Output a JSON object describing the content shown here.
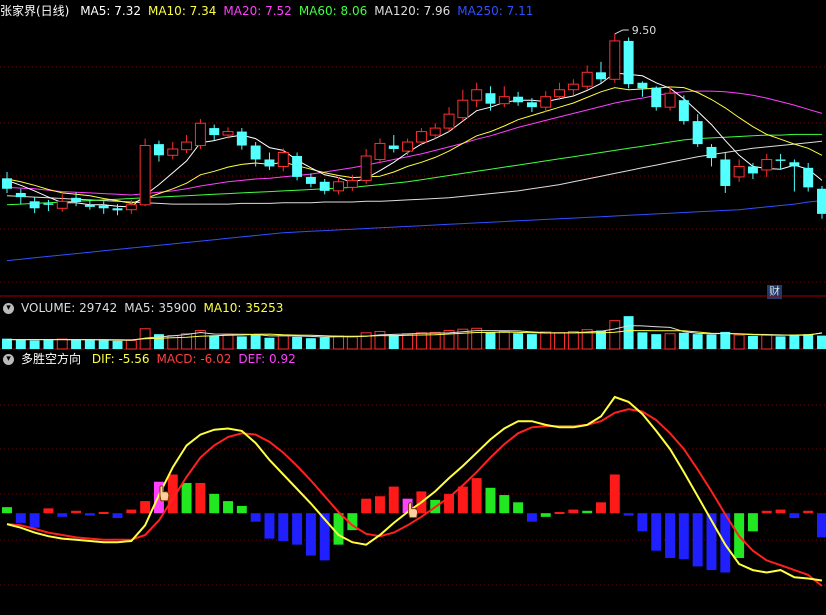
{
  "main_legend": {
    "name": "张家界(日线)",
    "items": [
      {
        "label": "MA5: 7.32",
        "color": "#ffffff"
      },
      {
        "label": "MA10: 7.34",
        "color": "#ffff40"
      },
      {
        "label": "MA20: 7.52",
        "color": "#ff40ff"
      },
      {
        "label": "MA60: 8.06",
        "color": "#40ff40"
      },
      {
        "label": "MA120: 7.96",
        "color": "#dddddd"
      },
      {
        "label": "MA250: 7.11",
        "color": "#3050ff"
      }
    ]
  },
  "volume_legend": {
    "items": [
      {
        "label": "VOLUME: 29742",
        "color": "#dddddd"
      },
      {
        "label": "MA5: 35900",
        "color": "#dddddd"
      },
      {
        "label": "MA10: 35253",
        "color": "#ffff40"
      }
    ]
  },
  "indicator_legend": {
    "name": "多胜空方向",
    "items": [
      {
        "label": "DIF: -5.56",
        "color": "#ffff40"
      },
      {
        "label": "MACD: -6.02",
        "color": "#ff4040"
      },
      {
        "label": "DEF: 0.92",
        "color": "#ff40ff"
      }
    ]
  },
  "badge": "财",
  "chart_data": {
    "type": "candlestick",
    "price_ylim": [
      5.9,
      9.7
    ],
    "high_marker": "9.50",
    "candles": [
      [
        7.43,
        7.28,
        7.52,
        7.22
      ],
      [
        7.22,
        7.16,
        7.28,
        7.06
      ],
      [
        7.1,
        7.0,
        7.16,
        6.93
      ],
      [
        7.07,
        7.05,
        7.12,
        6.96
      ],
      [
        7.0,
        7.1,
        7.2,
        6.95
      ],
      [
        7.15,
        7.09,
        7.23,
        7.03
      ],
      [
        7.05,
        7.02,
        7.12,
        6.98
      ],
      [
        7.04,
        7.0,
        7.1,
        6.92
      ],
      [
        7.0,
        6.97,
        7.06,
        6.9
      ],
      [
        6.98,
        7.05,
        7.12,
        6.92
      ],
      [
        7.05,
        7.9,
        8.0,
        7.03
      ],
      [
        7.92,
        7.76,
        7.97,
        7.67
      ],
      [
        7.76,
        7.85,
        7.95,
        7.7
      ],
      [
        7.84,
        7.95,
        8.05,
        7.79
      ],
      [
        7.9,
        8.22,
        8.28,
        7.85
      ],
      [
        8.15,
        8.05,
        8.2,
        7.98
      ],
      [
        8.05,
        8.1,
        8.16,
        8.0
      ],
      [
        8.1,
        7.9,
        8.15,
        7.84
      ],
      [
        7.9,
        7.7,
        7.95,
        7.6
      ],
      [
        7.7,
        7.6,
        7.8,
        7.55
      ],
      [
        7.6,
        7.8,
        7.86,
        7.53
      ],
      [
        7.75,
        7.45,
        7.8,
        7.4
      ],
      [
        7.45,
        7.35,
        7.5,
        7.3
      ],
      [
        7.38,
        7.25,
        7.42,
        7.2
      ],
      [
        7.25,
        7.38,
        7.45,
        7.2
      ],
      [
        7.3,
        7.4,
        7.48,
        7.25
      ],
      [
        7.4,
        7.75,
        7.85,
        7.35
      ],
      [
        7.7,
        7.93,
        8.0,
        7.65
      ],
      [
        7.9,
        7.85,
        8.05,
        7.8
      ],
      [
        7.82,
        7.95,
        8.0,
        7.76
      ],
      [
        7.95,
        8.1,
        8.15,
        7.9
      ],
      [
        8.05,
        8.15,
        8.22,
        8.0
      ],
      [
        8.15,
        8.35,
        8.45,
        8.1
      ],
      [
        8.3,
        8.55,
        8.7,
        8.25
      ],
      [
        8.55,
        8.7,
        8.8,
        8.45
      ],
      [
        8.65,
        8.5,
        8.75,
        8.4
      ],
      [
        8.5,
        8.6,
        8.75,
        8.45
      ],
      [
        8.6,
        8.52,
        8.67,
        8.47
      ],
      [
        8.52,
        8.45,
        8.58,
        8.38
      ],
      [
        8.45,
        8.6,
        8.68,
        8.38
      ],
      [
        8.6,
        8.7,
        8.8,
        8.55
      ],
      [
        8.7,
        8.78,
        8.85,
        8.62
      ],
      [
        8.75,
        8.95,
        9.05,
        8.7
      ],
      [
        8.95,
        8.85,
        9.1,
        8.8
      ],
      [
        8.85,
        9.4,
        9.5,
        8.8
      ],
      [
        9.4,
        8.78,
        9.45,
        8.72
      ],
      [
        8.8,
        8.72,
        8.82,
        8.6
      ],
      [
        8.73,
        8.45,
        8.75,
        8.4
      ],
      [
        8.45,
        8.65,
        8.75,
        8.4
      ],
      [
        8.55,
        8.25,
        8.62,
        8.2
      ],
      [
        8.25,
        7.92,
        8.35,
        7.88
      ],
      [
        7.88,
        7.72,
        7.92,
        7.6
      ],
      [
        7.7,
        7.32,
        7.8,
        7.22
      ],
      [
        7.45,
        7.6,
        7.7,
        7.38
      ],
      [
        7.6,
        7.5,
        7.65,
        7.42
      ],
      [
        7.55,
        7.7,
        7.78,
        7.45
      ],
      [
        7.7,
        7.68,
        7.78,
        7.56
      ],
      [
        7.66,
        7.6,
        7.7,
        7.24
      ],
      [
        7.58,
        7.3,
        7.65,
        7.24
      ],
      [
        7.28,
        6.92,
        7.32,
        6.85
      ]
    ],
    "ma5": [
      7.4,
      7.33,
      7.25,
      7.16,
      7.08,
      7.08,
      7.05,
      7.05,
      7.03,
      7.02,
      7.19,
      7.34,
      7.51,
      7.68,
      7.94,
      7.97,
      8.02,
      8.05,
      8.0,
      7.87,
      7.83,
      7.69,
      7.58,
      7.48,
      7.44,
      7.37,
      7.43,
      7.54,
      7.66,
      7.8,
      7.92,
      8.0,
      8.1,
      8.25,
      8.4,
      8.45,
      8.52,
      8.55,
      8.55,
      8.53,
      8.57,
      8.61,
      8.69,
      8.79,
      8.94,
      8.92,
      8.9,
      8.8,
      8.72,
      8.57,
      8.39,
      8.2,
      7.97,
      7.76,
      7.6,
      7.57,
      7.56,
      7.62,
      7.56,
      7.4
    ],
    "ma10": [
      7.42,
      7.38,
      7.33,
      7.27,
      7.22,
      7.2,
      7.18,
      7.14,
      7.11,
      7.07,
      7.14,
      7.21,
      7.28,
      7.36,
      7.48,
      7.53,
      7.59,
      7.63,
      7.65,
      7.63,
      7.66,
      7.61,
      7.56,
      7.51,
      7.47,
      7.44,
      7.45,
      7.46,
      7.52,
      7.6,
      7.66,
      7.73,
      7.82,
      7.93,
      8.04,
      8.1,
      8.18,
      8.27,
      8.33,
      8.39,
      8.45,
      8.51,
      8.59,
      8.67,
      8.73,
      8.7,
      8.71,
      8.72,
      8.74,
      8.73,
      8.66,
      8.56,
      8.44,
      8.3,
      8.17,
      8.06,
      7.99,
      7.92,
      7.86,
      7.76
    ],
    "ma20": [
      7.3,
      7.29,
      7.28,
      7.26,
      7.24,
      7.23,
      7.22,
      7.21,
      7.2,
      7.19,
      7.21,
      7.23,
      7.25,
      7.28,
      7.32,
      7.35,
      7.38,
      7.4,
      7.42,
      7.43,
      7.45,
      7.47,
      7.49,
      7.52,
      7.55,
      7.58,
      7.62,
      7.66,
      7.7,
      7.74,
      7.78,
      7.83,
      7.88,
      7.93,
      7.99,
      8.04,
      8.1,
      8.16,
      8.21,
      8.26,
      8.31,
      8.36,
      8.41,
      8.46,
      8.51,
      8.55,
      8.58,
      8.62,
      8.65,
      8.67,
      8.68,
      8.68,
      8.67,
      8.65,
      8.62,
      8.58,
      8.53,
      8.48,
      8.42,
      8.36
    ],
    "ma60": [
      7.05,
      7.06,
      7.07,
      7.08,
      7.09,
      7.1,
      7.11,
      7.12,
      7.13,
      7.14,
      7.15,
      7.16,
      7.17,
      7.18,
      7.19,
      7.2,
      7.21,
      7.22,
      7.23,
      7.24,
      7.25,
      7.26,
      7.27,
      7.28,
      7.29,
      7.3,
      7.32,
      7.34,
      7.36,
      7.38,
      7.41,
      7.44,
      7.47,
      7.5,
      7.53,
      7.56,
      7.59,
      7.62,
      7.65,
      7.68,
      7.71,
      7.74,
      7.77,
      7.8,
      7.83,
      7.86,
      7.89,
      7.92,
      7.95,
      7.98,
      8.0,
      8.01,
      8.02,
      8.03,
      8.04,
      8.05,
      8.05,
      8.06,
      8.06,
      8.06
    ],
    "ma120": [
      7.18,
      7.17,
      7.16,
      7.15,
      7.14,
      7.13,
      7.12,
      7.11,
      7.1,
      7.09,
      7.08,
      7.07,
      7.06,
      7.06,
      7.06,
      7.06,
      7.06,
      7.07,
      7.07,
      7.07,
      7.08,
      7.08,
      7.08,
      7.09,
      7.09,
      7.09,
      7.1,
      7.1,
      7.11,
      7.12,
      7.13,
      7.14,
      7.15,
      7.17,
      7.19,
      7.21,
      7.23,
      7.25,
      7.28,
      7.31,
      7.34,
      7.38,
      7.42,
      7.46,
      7.5,
      7.54,
      7.58,
      7.62,
      7.66,
      7.7,
      7.74,
      7.77,
      7.8,
      7.83,
      7.86,
      7.88,
      7.9,
      7.92,
      7.94,
      7.96
    ],
    "ma250": [
      6.25,
      6.27,
      6.29,
      6.31,
      6.33,
      6.35,
      6.37,
      6.39,
      6.41,
      6.43,
      6.45,
      6.47,
      6.49,
      6.51,
      6.53,
      6.55,
      6.57,
      6.59,
      6.61,
      6.63,
      6.65,
      6.66,
      6.67,
      6.68,
      6.69,
      6.7,
      6.71,
      6.72,
      6.73,
      6.74,
      6.75,
      6.76,
      6.77,
      6.78,
      6.79,
      6.8,
      6.81,
      6.82,
      6.83,
      6.84,
      6.85,
      6.86,
      6.87,
      6.88,
      6.89,
      6.9,
      6.91,
      6.92,
      6.93,
      6.94,
      6.95,
      6.96,
      6.97,
      6.98,
      7.0,
      7.02,
      7.04,
      7.06,
      7.09,
      7.11
    ],
    "volume_ylim": [
      0,
      80000
    ],
    "volume": [
      23000,
      21000,
      19000,
      20000,
      22000,
      21000,
      20000,
      19000,
      18000,
      19000,
      45000,
      33000,
      30000,
      34000,
      41000,
      29000,
      31000,
      28000,
      33000,
      25000,
      31000,
      27000,
      24000,
      26000,
      29000,
      27000,
      36000,
      39000,
      31000,
      34000,
      36000,
      37000,
      41000,
      44000,
      46000,
      37000,
      39000,
      35000,
      33000,
      38000,
      36000,
      39000,
      43000,
      41000,
      63000,
      73000,
      37000,
      33000,
      34000,
      36000,
      33000,
      32000,
      38000,
      31000,
      29000,
      31000,
      28000,
      32000,
      33000,
      29742
    ],
    "volume_ma5": [
      21000,
      21000,
      21000,
      21000,
      21000,
      20600,
      20400,
      20000,
      19600,
      19400,
      24200,
      26800,
      29000,
      32200,
      36600,
      33400,
      33000,
      32600,
      32400,
      29200,
      29600,
      28800,
      28000,
      26600,
      27400,
      27200,
      28400,
      31400,
      32400,
      33400,
      35200,
      35400,
      35800,
      38400,
      40800,
      41000,
      40600,
      40200,
      38000,
      36400,
      36200,
      36000,
      37800,
      39400,
      44400,
      51800,
      51400,
      49400,
      48000,
      38600,
      34600,
      33600,
      34600,
      34000,
      32600,
      32200,
      31400,
      30600,
      30600,
      35900
    ],
    "volume_ma10": [
      21000,
      21000,
      21000,
      21000,
      21000,
      21000,
      21000,
      20800,
      20600,
      20300,
      22600,
      23800,
      24900,
      26300,
      28500,
      29300,
      30400,
      31200,
      32700,
      33000,
      31600,
      31000,
      30400,
      29600,
      28400,
      28200,
      28700,
      29800,
      29600,
      30500,
      31100,
      31700,
      33400,
      35200,
      36700,
      36800,
      37500,
      36900,
      36100,
      35600,
      35600,
      35800,
      36000,
      35700,
      37400,
      41000,
      40800,
      40600,
      40700,
      40500,
      37800,
      34900,
      34400,
      33400,
      31700,
      31100,
      30700,
      31100,
      31800,
      35253
    ],
    "indicator_ylim": [
      -8,
      12
    ],
    "dif": [
      -0.9,
      -1.2,
      -1.6,
      -1.9,
      -2.1,
      -2.2,
      -2.3,
      -2.4,
      -2.4,
      -2.3,
      -1.0,
      1.5,
      3.8,
      5.6,
      6.5,
      6.9,
      7.0,
      6.8,
      5.8,
      4.4,
      3.2,
      2.0,
      0.8,
      -0.5,
      -1.8,
      -2.4,
      -2.6,
      -1.8,
      -0.8,
      0.1,
      0.9,
      1.8,
      2.9,
      3.9,
      5.0,
      6.1,
      7.0,
      7.6,
      7.6,
      7.3,
      7.1,
      7.1,
      7.3,
      8.0,
      9.6,
      9.2,
      8.2,
      6.8,
      5.3,
      3.4,
      1.4,
      -0.6,
      -2.6,
      -4.2,
      -4.7,
      -4.9,
      -4.7,
      -5.3,
      -5.4,
      -5.56
    ],
    "dea": [
      -0.9,
      -1.0,
      -1.3,
      -1.6,
      -1.8,
      -2.0,
      -2.1,
      -2.2,
      -2.2,
      -2.2,
      -1.8,
      -0.6,
      1.2,
      3.0,
      4.6,
      5.6,
      6.3,
      6.6,
      6.5,
      5.9,
      5.0,
      3.9,
      2.7,
      1.4,
      0.1,
      -1.0,
      -1.7,
      -1.9,
      -1.6,
      -1.0,
      -0.3,
      0.5,
      1.3,
      2.3,
      3.4,
      4.6,
      5.7,
      6.6,
      7.1,
      7.2,
      7.2,
      7.2,
      7.3,
      7.6,
      8.3,
      8.6,
      8.4,
      7.7,
      6.6,
      5.3,
      3.6,
      1.8,
      -0.1,
      -1.9,
      -3.1,
      -3.9,
      -4.3,
      -4.7,
      -5.1,
      -6.02
    ],
    "bars": [
      0.5,
      -0.8,
      -1.2,
      0.4,
      -0.3,
      0.2,
      -0.2,
      0.1,
      -0.4,
      0.3,
      1.0,
      2.6,
      3.2,
      2.5,
      2.5,
      1.6,
      1.0,
      0.6,
      -0.7,
      -2.1,
      -2.3,
      -2.6,
      -3.5,
      -3.9,
      -2.6,
      -1.4,
      1.2,
      1.4,
      2.2,
      1.2,
      1.8,
      1.1,
      1.6,
      2.2,
      2.9,
      2.1,
      1.5,
      0.9,
      -0.7,
      -0.3,
      0.1,
      0.3,
      0.2,
      0.9,
      3.2,
      -0.2,
      -1.5,
      -3.1,
      -3.7,
      -3.8,
      -4.4,
      -4.7,
      -4.9,
      -3.7,
      -1.5,
      0.2,
      0.3,
      -0.4,
      0.2,
      -2.0
    ],
    "signal_bars": [
      11,
      29
    ]
  }
}
